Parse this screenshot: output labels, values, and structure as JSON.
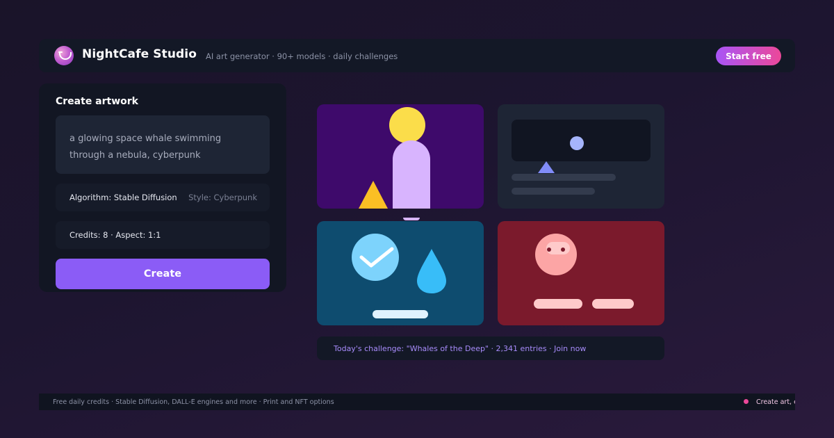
{
  "header": {
    "brand": "NightCafe Studio",
    "tagline": "AI art generator · 90+ models · daily challenges",
    "cta_label": "Start free"
  },
  "create_panel": {
    "title": "Create artwork",
    "prompt_line1": "a glowing space whale swimming",
    "prompt_line2": "through a nebula, cyberpunk",
    "algorithm": "Algorithm: Stable Diffusion",
    "style": "Style: Cyberpunk",
    "credits": "Credits: 8 · Aspect: 1:1",
    "create_label": "Create"
  },
  "gallery": {
    "artworks": [
      {
        "name": "artwork-portrait",
        "background": "#3e0a6b"
      },
      {
        "name": "artwork-landscape",
        "background": "#1e2535"
      },
      {
        "name": "artwork-check",
        "background": "#0e4c6f"
      },
      {
        "name": "artwork-face",
        "background": "#7b1a2c"
      }
    ]
  },
  "challenge": {
    "text": "Today's challenge: \"Whales of the Deep\" · 2,341 entries · Join now"
  },
  "ticker": {
    "left": "Free daily credits · Stable Diffusion, DALL-E engines and more · Print and NFT options",
    "right": "Create art, earn credits, join"
  },
  "colors": {
    "accent": "#8b5cf6",
    "gradient_start": "#a855f7",
    "gradient_end": "#ec4899",
    "challenge_text": "#a78bfa"
  }
}
